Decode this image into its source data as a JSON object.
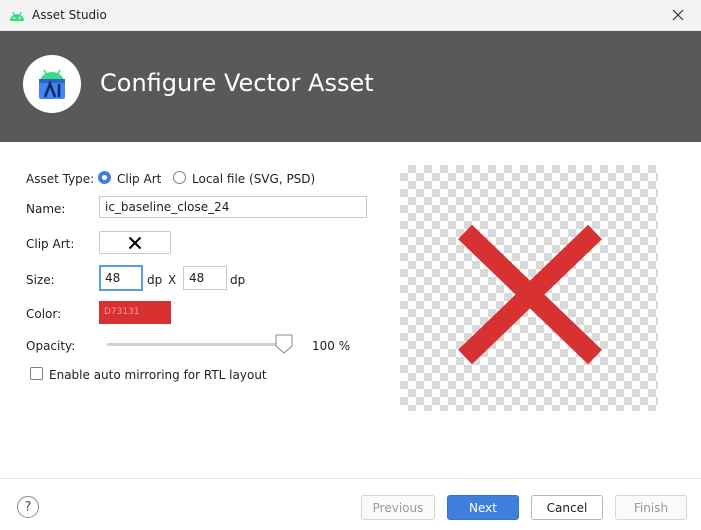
{
  "window": {
    "title": "Asset Studio",
    "close_icon": "close-icon",
    "app_icon": "android-icon"
  },
  "banner": {
    "heading": "Configure Vector Asset",
    "logo_icon": "android-studio-logo-icon"
  },
  "form": {
    "asset_type": {
      "label": "Asset Type:",
      "options": [
        {
          "label": "Clip Art",
          "selected": true
        },
        {
          "label": "Local file (SVG, PSD)",
          "selected": false
        }
      ]
    },
    "name": {
      "label": "Name:",
      "value": "ic_baseline_close_24"
    },
    "clip_art": {
      "label": "Clip Art:",
      "icon": "close-icon"
    },
    "size": {
      "label": "Size:",
      "width": "48",
      "width_unit": "dp",
      "separator": "X",
      "height": "48",
      "height_unit": "dp"
    },
    "color": {
      "label": "Color:",
      "value": "D73131",
      "hex": "#D73131"
    },
    "opacity": {
      "label": "Opacity:",
      "value_text": "100 %",
      "value_fraction": 1.0
    },
    "auto_mirror": {
      "label": "Enable auto mirroring for RTL layout",
      "checked": false
    }
  },
  "preview": {
    "icon": "close-icon",
    "color": "#D73131"
  },
  "footer": {
    "help_label": "?",
    "buttons": {
      "previous": "Previous",
      "next": "Next",
      "cancel": "Cancel",
      "finish": "Finish"
    }
  },
  "colors": {
    "accent": "#3F80DD",
    "banner_bg": "#595959",
    "icon_red": "#D73131"
  }
}
